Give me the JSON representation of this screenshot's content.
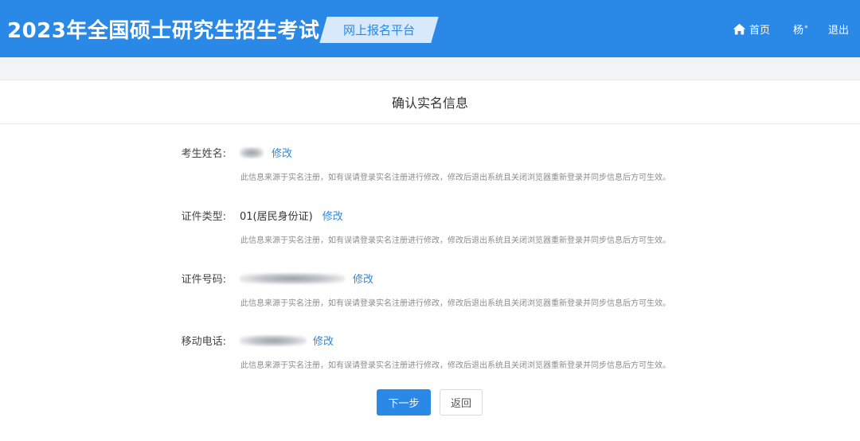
{
  "header": {
    "app_title": "2023年全国硕士研究生招生考试",
    "platform_label": "网上报名平台",
    "nav_home": "首页",
    "nav_user": "杨",
    "nav_user_mark": "*",
    "nav_logout": "退出",
    "brand_color": "#2a88e6"
  },
  "page": {
    "title": "确认实名信息"
  },
  "fields": [
    {
      "label": "考生姓名:",
      "value": "",
      "edit_label": "修改",
      "note": "此信息来源于实名注册，如有误请登录实名注册进行修改，修改后退出系统且关闭浏览器重新登录并同步信息后方可生效。"
    },
    {
      "label": "证件类型:",
      "value": "01(居民身份证)",
      "edit_label": "修改",
      "note": "此信息来源于实名注册，如有误请登录实名注册进行修改，修改后退出系统且关闭浏览器重新登录并同步信息后方可生效。"
    },
    {
      "label": "证件号码:",
      "value": "",
      "edit_label": "修改",
      "note": "此信息来源于实名注册，如有误请登录实名注册进行修改，修改后退出系统且关闭浏览器重新登录并同步信息后方可生效。"
    },
    {
      "label": "移动电话:",
      "value": "",
      "edit_label": "修改",
      "note": "此信息来源于实名注册，如有误请登录实名注册进行修改，修改后退出系统且关闭浏览器重新登录并同步信息后方可生效。"
    }
  ],
  "actions": {
    "next_label": "下一步",
    "back_label": "返回"
  },
  "icons": {
    "home": "home-icon"
  }
}
